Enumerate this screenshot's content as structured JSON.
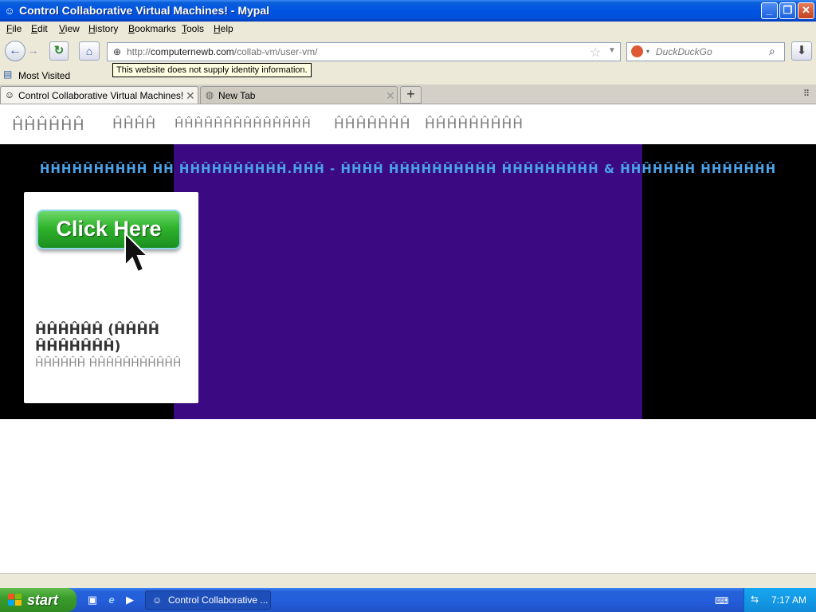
{
  "window": {
    "title": "Control Collaborative Virtual Machines! - Mypal",
    "controls": [
      "minimize",
      "restore",
      "close"
    ]
  },
  "menubar": {
    "items": [
      {
        "label": "File",
        "accel": "F",
        "rest": "ile"
      },
      {
        "label": "Edit",
        "accel": "E",
        "rest": "dit"
      },
      {
        "label": "View",
        "accel": "V",
        "rest": "iew"
      },
      {
        "label": "History",
        "accel": "H",
        "rest": "istory"
      },
      {
        "label": "Bookmarks",
        "accel": "B",
        "rest": "ookmarks"
      },
      {
        "label": "Tools",
        "accel": "T",
        "rest": "ools"
      },
      {
        "label": "Help",
        "accel": "H",
        "rest": "elp"
      }
    ]
  },
  "navbar": {
    "url_prefix": "http://",
    "url_domain": "computernewb.com",
    "url_path": "/collab-vm/user-vm/",
    "search_placeholder": "DuckDuckGo",
    "identity_tooltip": "This website does not supply identity information."
  },
  "bookmarks": {
    "most_visited": "Most Visited"
  },
  "tabs": [
    {
      "label": "Control Collaborative Virtual Machines!",
      "active": true
    },
    {
      "label": "New Tab",
      "active": false
    }
  ],
  "page": {
    "nav_links": [
      "ĤĤĤĤĤĤ",
      "ĤĤĤĤ",
      "ĤĤĤĤĤĤĤĤĤĤĤĤĤĤ",
      "ĤĤĤĤĤĤĤ",
      "ĤĤĤĤĤĤĤĤĤ"
    ],
    "hero_heading": "ĤĤĤĤĤĤĤĤĤĤ ĤĤ ĤĤĤĤĤĤĤĤĤĤ.ĤĤĤ - ĤĤĤĤ ĤĤĤĤĤĤĤĤĤĤ ĤĤĤĤĤĤĤĤĤ & ĤĤĤĤĤĤĤ ĤĤĤĤĤĤĤ",
    "hero_colors": {
      "outer": "#000000",
      "center": "#3b0a82",
      "heading": "#4aa3e8"
    },
    "card": {
      "button_text": "Click Here",
      "title": "ĤĤĤĤĤĤ (ĤĤĤĤ ĤĤĤĤĤĤĤ)",
      "subtitle": "ĤĤĤĤĤĤ ĤĤĤĤĤĤĤĤĤĤĤ"
    }
  },
  "taskbar": {
    "start_label": "start",
    "task_item": "Control Collaborative ...",
    "clock": "7:17 AM"
  }
}
